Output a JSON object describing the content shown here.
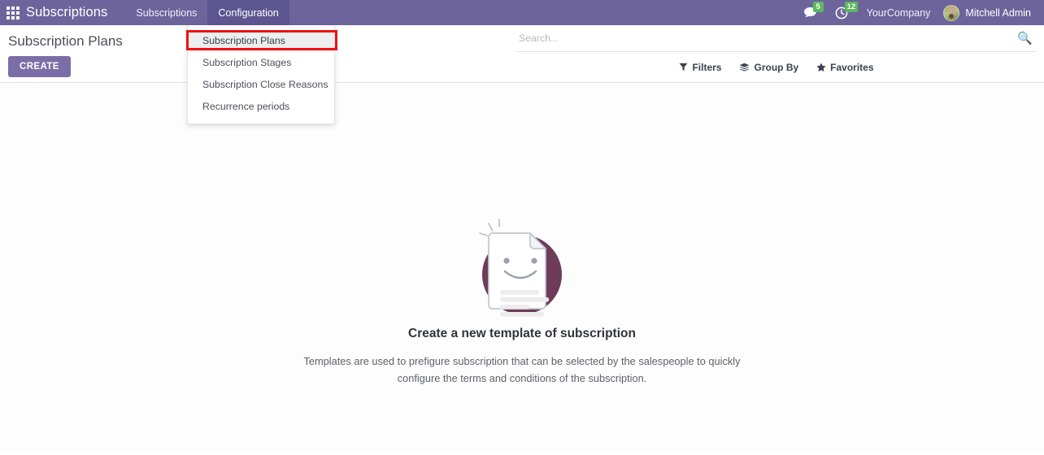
{
  "navbar": {
    "apps_icon": "apps-grid-icon",
    "brand": "Subscriptions",
    "menus": [
      {
        "label": "Subscriptions",
        "active": false
      },
      {
        "label": "Configuration",
        "active": true
      }
    ],
    "systray": {
      "messages_icon": "speech-bubble-icon",
      "messages_count": "5",
      "activities_icon": "clock-icon",
      "activities_count": "12",
      "company": "YourCompany",
      "avatar_icon": "user-avatar",
      "user": "Mitchell Admin"
    }
  },
  "dropdown": {
    "items": [
      {
        "label": "Subscription Plans",
        "highlighted": true
      },
      {
        "label": "Subscription Stages",
        "highlighted": false
      },
      {
        "label": "Subscription Close Reasons",
        "highlighted": false
      },
      {
        "label": "Recurrence periods",
        "highlighted": false
      }
    ],
    "highlight_color": "#ee1111"
  },
  "control_panel": {
    "title": "Subscription Plans",
    "create_label": "CREATE",
    "search": {
      "placeholder": "Search...",
      "value": "",
      "icon": "search-icon"
    },
    "filters": [
      {
        "label": "Filters",
        "icon": "funnel-icon"
      },
      {
        "label": "Group By",
        "icon": "layers-icon"
      },
      {
        "label": "Favorites",
        "icon": "star-icon"
      }
    ]
  },
  "empty_state": {
    "illustration": "smiling-document-icon",
    "title": "Create a new template of subscription",
    "description": "Templates are used to prefigure subscription that can be selected by the salespeople to quickly configure the terms and conditions of the subscription."
  },
  "colors": {
    "navbar": "#6d649c",
    "navbar_active": "#5e5690",
    "accent": "#7b6ea8",
    "badge": "#5cb85c",
    "illustration_circle": "#6e3b59"
  }
}
